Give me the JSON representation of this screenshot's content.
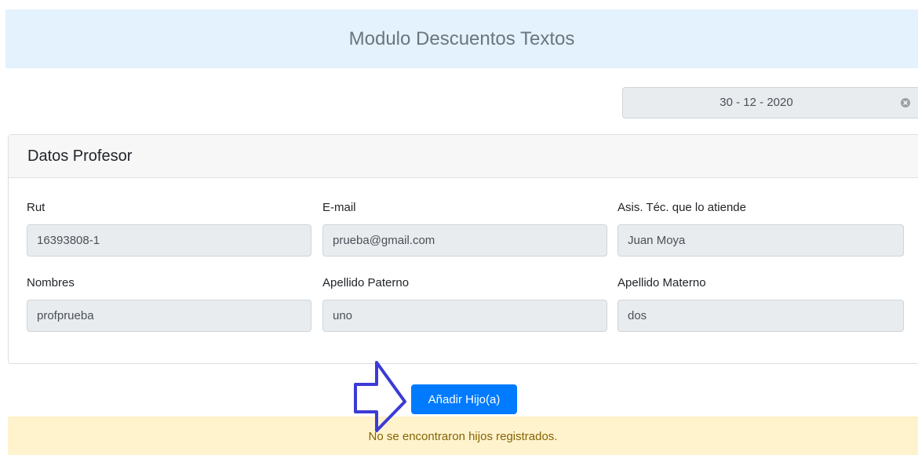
{
  "header": {
    "title": "Modulo Descuentos Textos"
  },
  "date_filter": {
    "value": "30 - 12 - 2020",
    "clear_icon": "clear-circle-icon"
  },
  "card": {
    "title": "Datos Profesor",
    "fields": [
      {
        "label": "Rut",
        "value": "16393808-1"
      },
      {
        "label": "E-mail",
        "value": "prueba@gmail.com"
      },
      {
        "label": "Asis. Téc. que lo atiende",
        "value": "Juan Moya"
      },
      {
        "label": "Nombres",
        "value": "profprueba"
      },
      {
        "label": "Apellido Paterno",
        "value": "uno"
      },
      {
        "label": "Apellido Materno",
        "value": "dos"
      }
    ]
  },
  "actions": {
    "add_child_label": "Añadir Hijo(a)"
  },
  "alert": {
    "message": "No se encontraron hijos registrados."
  },
  "colors": {
    "primary": "#007bff",
    "header_bg": "#e3f2fd",
    "alert_bg": "#fff3cd",
    "annotation_arrow": "#3b3bd6"
  }
}
